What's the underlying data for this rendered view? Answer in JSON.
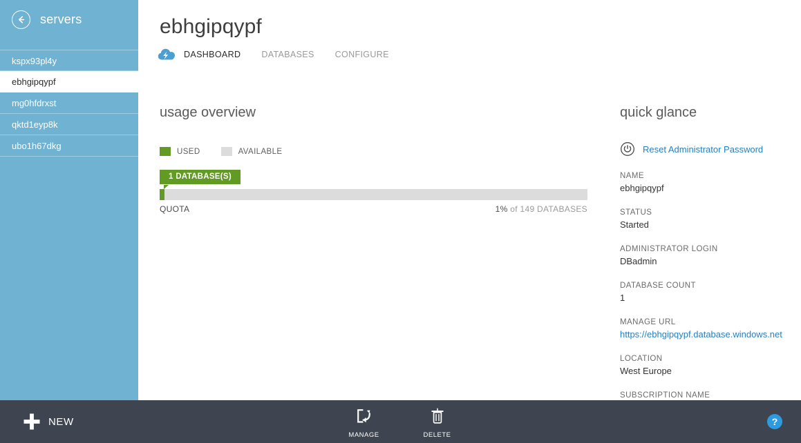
{
  "sidebar": {
    "back_label": "servers",
    "back_icon": "back-arrow-icon",
    "items": [
      {
        "label": "kspx93pl4y",
        "selected": false
      },
      {
        "label": "ebhgipqypf",
        "selected": true
      },
      {
        "label": "mg0hfdrxst",
        "selected": false
      },
      {
        "label": "qktd1eyp8k",
        "selected": false
      },
      {
        "label": "ubo1h67dkg",
        "selected": false
      }
    ]
  },
  "header": {
    "title": "ebhgipqypf",
    "icon": "sql-database-cloud-icon",
    "tabs": [
      {
        "label": "DASHBOARD",
        "active": true
      },
      {
        "label": "DATABASES",
        "active": false
      },
      {
        "label": "CONFIGURE",
        "active": false
      }
    ]
  },
  "usage": {
    "heading": "usage overview",
    "legend": [
      {
        "label": "USED",
        "color": "#629b23"
      },
      {
        "label": "AVAILABLE",
        "color": "#dcdcdc"
      }
    ],
    "callout": "1 DATABASE(S)",
    "quota_label": "QUOTA",
    "quota_percent": "1%",
    "quota_rest": "of 149 DATABASES"
  },
  "chart_data": {
    "type": "bar",
    "title": "usage overview",
    "categories": [
      "QUOTA"
    ],
    "series": [
      {
        "name": "USED",
        "values": [
          1
        ],
        "color": "#629b23"
      },
      {
        "name": "AVAILABLE",
        "values": [
          99
        ],
        "color": "#dcdcdc"
      }
    ],
    "value_label": "1 DATABASE(S)",
    "total": 149,
    "unit": "DATABASES",
    "percent_used": 1,
    "ylim": [
      0,
      100
    ],
    "legend_position": "top-left",
    "grid": false
  },
  "glance": {
    "heading": "quick glance",
    "reset_icon": "reset-password-icon",
    "reset_link": "Reset Administrator Password",
    "fields": [
      {
        "label": "NAME",
        "value": "ebhgipqypf",
        "is_link": false
      },
      {
        "label": "STATUS",
        "value": "Started",
        "is_link": false
      },
      {
        "label": "ADMINISTRATOR LOGIN",
        "value": "DBadmin",
        "is_link": false
      },
      {
        "label": "DATABASE COUNT",
        "value": "1",
        "is_link": false
      },
      {
        "label": "MANAGE URL",
        "value": "https://ebhgipqypf.database.windows.net",
        "is_link": true
      },
      {
        "label": "LOCATION",
        "value": "West Europe",
        "is_link": false
      },
      {
        "label": "SUBSCRIPTION NAME",
        "value": "",
        "is_link": false
      }
    ]
  },
  "bottombar": {
    "new_label": "NEW",
    "new_icon": "plus-icon",
    "commands": [
      {
        "label": "MANAGE",
        "icon": "manage-icon"
      },
      {
        "label": "DELETE",
        "icon": "trash-icon"
      }
    ],
    "help_label": "?"
  },
  "colors": {
    "sidebar_blue": "#6fb2d2",
    "bottom_dark": "#3e4550",
    "accent_green": "#629b23",
    "track_gray": "#dcdcdc",
    "link_blue": "#2580c0",
    "help_blue": "#2e9bdf"
  }
}
